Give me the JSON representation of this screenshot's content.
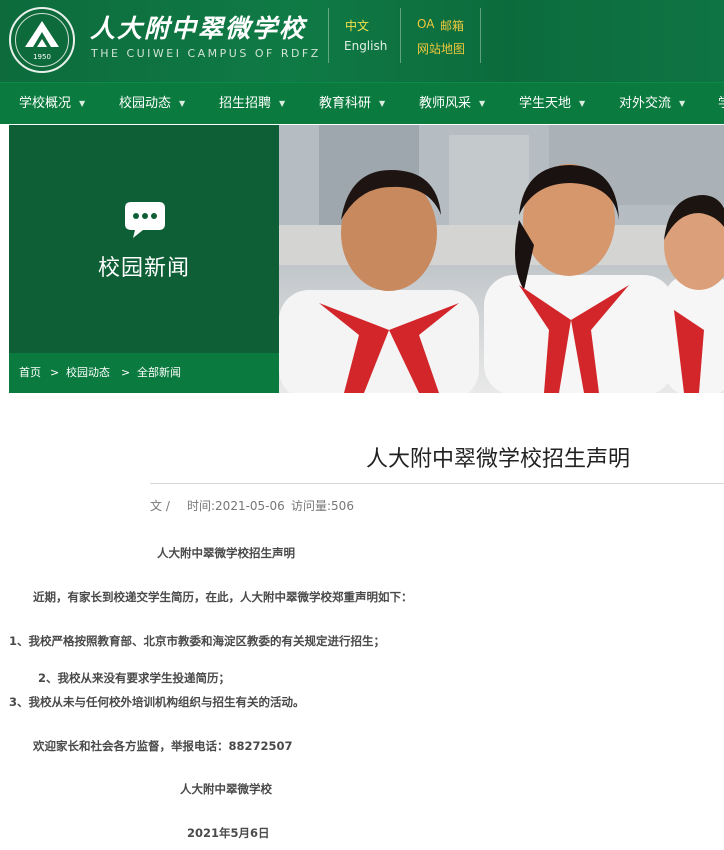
{
  "header": {
    "school_title": "人大附中翠微学校",
    "school_subtitle": "THE CUIWEI CAMPUS OF RDFZ",
    "emblem_year": "1950",
    "links": {
      "chinese": "中文",
      "english": "English",
      "oa": "OA",
      "mail": "邮箱",
      "sitemap": "网站地图"
    }
  },
  "nav": {
    "items": [
      {
        "label": "学校概况"
      },
      {
        "label": "校园动态"
      },
      {
        "label": "招生招聘"
      },
      {
        "label": "教育科研"
      },
      {
        "label": "教师风采"
      },
      {
        "label": "学生天地"
      },
      {
        "label": "对外交流"
      },
      {
        "label": "学"
      }
    ]
  },
  "banner": {
    "section_title": "校园新闻",
    "breadcrumb": [
      "首页",
      "校园动态",
      "全部新闻"
    ],
    "separator": ">"
  },
  "article": {
    "title": "人大附中翠微学校招生声明",
    "meta": {
      "author_label": "文 /",
      "time_label": "时间:2021-05-06",
      "views_label": "访问量:506"
    },
    "paragraphs": {
      "heading": "人大附中翠微学校招生声明",
      "intro": "近期，有家长到校递交学生简历，在此，人大附中翠微学校郑重声明如下：",
      "item1": "1、我校严格按照教育部、北京市教委和海淀区教委的有关规定进行招生；",
      "item2": "2、我校从来没有要求学生投递简历；",
      "item3": "3、我校从未与任何校外培训机构组织与招生有关的活动。",
      "welcome": "欢迎家长和社会各方监督，举报电话：88272507",
      "signature": "人大附中翠微学校",
      "date": "2021年5月6日"
    }
  },
  "colors": {
    "header_green": "#0d6b3c",
    "nav_green": "#0a7a3e",
    "banner_dark_green": "#0e5f36",
    "accent_yellow": "#f3e24a",
    "accent_orange": "#f0c83c"
  },
  "icons": {
    "emblem": "school-emblem-icon",
    "section": "chat-bubble-icon",
    "nav_caret": "caret-down-icon"
  }
}
